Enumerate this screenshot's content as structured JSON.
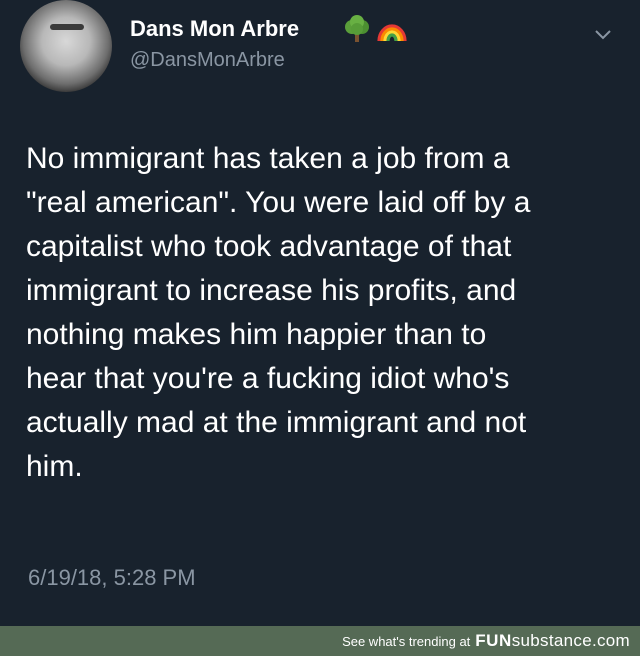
{
  "tweet": {
    "display_name": "Dans Mon Arbre",
    "handle": "@DansMonArbre",
    "badges": [
      "tree-emoji-icon",
      "rainbow-emoji-icon"
    ],
    "text_lines": [
      "No immigrant has taken a job from a",
      "\"real american\".  You were laid off by a",
      "capitalist who took advantage of that",
      "immigrant to increase his profits, and",
      "nothing makes him happier than to",
      "hear that you're a fucking idiot who's",
      "actually mad at the immigrant and not",
      "him."
    ],
    "timestamp": "6/19/18, 5:28 PM"
  },
  "footer": {
    "text": "See what's trending at",
    "brand_part1": "FUN",
    "brand_part2": "substance.com"
  },
  "colors": {
    "background": "#18222d",
    "secondary_text": "#8a96a3",
    "footer_bar": "#556a55"
  }
}
